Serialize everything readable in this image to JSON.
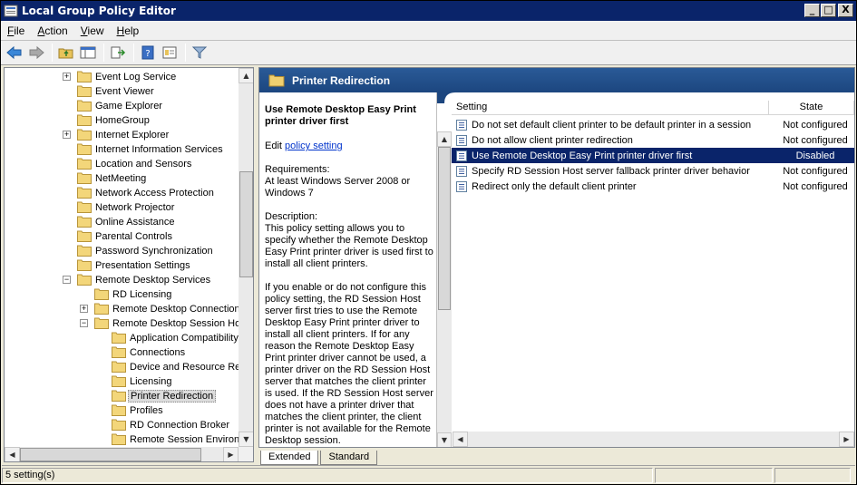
{
  "window": {
    "title": "Local Group Policy Editor"
  },
  "window_controls": {
    "minimize": "_",
    "maximize": "□",
    "close": "X"
  },
  "menu": [
    {
      "label": "File",
      "u": "F",
      "rest": "ile"
    },
    {
      "label": "Action",
      "u": "A",
      "rest": "ction"
    },
    {
      "label": "View",
      "u": "V",
      "rest": "iew"
    },
    {
      "label": "Help",
      "u": "H",
      "rest": "elp"
    }
  ],
  "toolbar": {
    "icons": [
      "back-arrow-icon",
      "forward-arrow-icon",
      "up-folder-icon",
      "show-hide-tree-icon",
      "export-list-icon",
      "help-icon",
      "properties-icon",
      "filter-icon"
    ]
  },
  "tree": {
    "items": [
      {
        "label": "Event Log Service",
        "expander": "+"
      },
      {
        "label": "Event Viewer",
        "expander": ""
      },
      {
        "label": "Game Explorer",
        "expander": ""
      },
      {
        "label": "HomeGroup",
        "expander": ""
      },
      {
        "label": "Internet Explorer",
        "expander": "+"
      },
      {
        "label": "Internet Information Services",
        "expander": ""
      },
      {
        "label": "Location and Sensors",
        "expander": ""
      },
      {
        "label": "NetMeeting",
        "expander": ""
      },
      {
        "label": "Network Access Protection",
        "expander": ""
      },
      {
        "label": "Network Projector",
        "expander": ""
      },
      {
        "label": "Online Assistance",
        "expander": ""
      },
      {
        "label": "Parental Controls",
        "expander": ""
      },
      {
        "label": "Password Synchronization",
        "expander": ""
      },
      {
        "label": "Presentation Settings",
        "expander": ""
      },
      {
        "label": "Remote Desktop Services",
        "expander": "−"
      },
      {
        "label": "RD Licensing",
        "expander": ""
      },
      {
        "label": "Remote Desktop Connection",
        "expander": "+"
      },
      {
        "label": "Remote Desktop Session Host",
        "expander": "−"
      },
      {
        "label": "Application Compatibility",
        "expander": ""
      },
      {
        "label": "Connections",
        "expander": ""
      },
      {
        "label": "Device and Resource Redirection",
        "expander": ""
      },
      {
        "label": "Licensing",
        "expander": ""
      },
      {
        "label": "Printer Redirection",
        "expander": "",
        "selected": true
      },
      {
        "label": "Profiles",
        "expander": ""
      },
      {
        "label": "RD Connection Broker",
        "expander": ""
      },
      {
        "label": "Remote Session Environment",
        "expander": ""
      }
    ]
  },
  "right_pane": {
    "header_title": "Printer Redirection",
    "description": {
      "title": "Use Remote Desktop Easy Print printer driver first",
      "edit_prefix": "Edit ",
      "edit_link": "policy setting",
      "requirements_label": "Requirements:",
      "requirements_text": "At least Windows Server 2008 or Windows 7",
      "description_label": "Description:",
      "description_text": "This policy setting allows you to specify whether the Remote Desktop Easy Print printer driver is used first to install all client printers.",
      "para2": "If you enable or do not configure this policy setting, the RD Session Host server first tries to use the Remote Desktop Easy Print printer driver to install all client printers. If for any reason the Remote Desktop Easy Print printer driver cannot be used, a printer driver on the RD Session Host server that matches the client printer is used. If the RD Session Host server does not have a printer driver that matches the client printer, the client printer is not available for the Remote Desktop session."
    },
    "list": {
      "columns": [
        "Setting",
        "State"
      ],
      "rows": [
        {
          "setting": "Do not set default client printer to be default printer in a session",
          "state": "Not configured"
        },
        {
          "setting": "Do not allow client printer redirection",
          "state": "Not configured"
        },
        {
          "setting": "Use Remote Desktop Easy Print printer driver first",
          "state": "Disabled",
          "selected": true
        },
        {
          "setting": "Specify RD Session Host server fallback printer driver behavior",
          "state": "Not configured"
        },
        {
          "setting": "Redirect only the default client printer",
          "state": "Not configured"
        }
      ]
    },
    "tabs": [
      "Extended",
      "Standard"
    ]
  },
  "status": {
    "text": "5 setting(s)"
  },
  "colors": {
    "title_bar": "#0a246a",
    "header_bar": "#1f4e8a",
    "selection": "#0a246a",
    "link": "#0033cc"
  }
}
